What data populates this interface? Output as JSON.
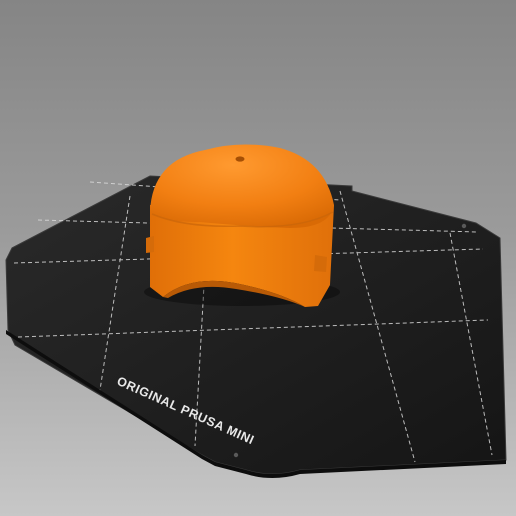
{
  "viewport": {
    "bed": {
      "label": "ORIGINAL PRUSA MINI",
      "surface_color": "#1e1e1e",
      "grid_color": "#d9d9d9"
    },
    "model": {
      "name": "",
      "color": "#f07d0e"
    }
  }
}
